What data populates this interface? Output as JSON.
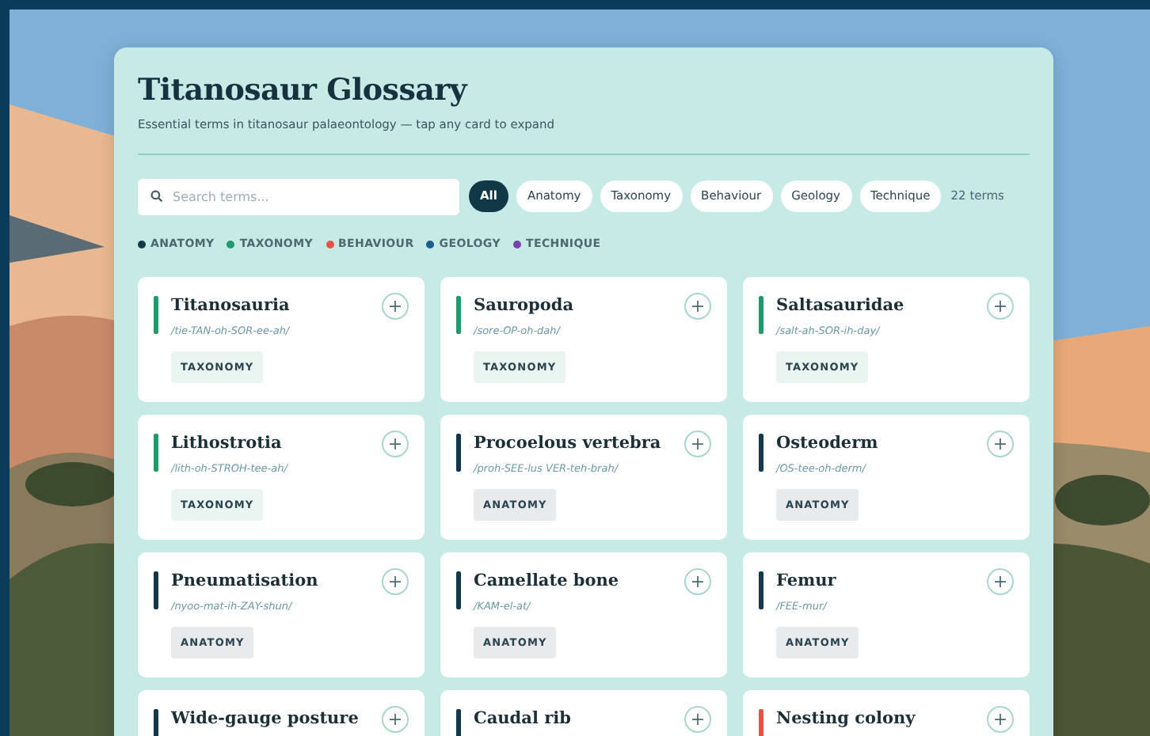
{
  "header": {
    "title": "Titanosaur Glossary",
    "subtitle": "Essential terms in titanosaur palaeontology — tap any card to expand"
  },
  "search": {
    "placeholder": "Search terms..."
  },
  "filters": [
    {
      "label": "All",
      "selected": true
    },
    {
      "label": "Anatomy",
      "selected": false
    },
    {
      "label": "Taxonomy",
      "selected": false
    },
    {
      "label": "Behaviour",
      "selected": false
    },
    {
      "label": "Geology",
      "selected": false
    },
    {
      "label": "Technique",
      "selected": false
    }
  ],
  "count": "22 terms",
  "legend": [
    {
      "label": "ANATOMY",
      "color": "#123a4a"
    },
    {
      "label": "TAXONOMY",
      "color": "#1f9a6a"
    },
    {
      "label": "BEHAVIOUR",
      "color": "#e8543f"
    },
    {
      "label": "GEOLOGY",
      "color": "#1f5f8f"
    },
    {
      "label": "TECHNIQUE",
      "color": "#7a3fb0"
    }
  ],
  "cards": [
    {
      "term": "Titanosauria",
      "pronunciation": "/tie-TAN-oh-SOR-ee-ah/",
      "tag": "TAXONOMY",
      "color": "#1f9a6a"
    },
    {
      "term": "Sauropoda",
      "pronunciation": "/sore-OP-oh-dah/",
      "tag": "TAXONOMY",
      "color": "#1f9a6a"
    },
    {
      "term": "Saltasauridae",
      "pronunciation": "/salt-ah-SOR-ih-day/",
      "tag": "TAXONOMY",
      "color": "#1f9a6a"
    },
    {
      "term": "Lithostrotia",
      "pronunciation": "/lith-oh-STROH-tee-ah/",
      "tag": "TAXONOMY",
      "color": "#1f9a6a"
    },
    {
      "term": "Procoelous vertebra",
      "pronunciation": "/proh-SEE-lus VER-teh-brah/",
      "tag": "ANATOMY",
      "color": "#123a4a"
    },
    {
      "term": "Osteoderm",
      "pronunciation": "/OS-tee-oh-derm/",
      "tag": "ANATOMY",
      "color": "#123a4a"
    },
    {
      "term": "Pneumatisation",
      "pronunciation": "/nyoo-mat-ih-ZAY-shun/",
      "tag": "ANATOMY",
      "color": "#123a4a"
    },
    {
      "term": "Camellate bone",
      "pronunciation": "/KAM-el-at/",
      "tag": "ANATOMY",
      "color": "#123a4a"
    },
    {
      "term": "Femur",
      "pronunciation": "/FEE-mur/",
      "tag": "ANATOMY",
      "color": "#123a4a"
    },
    {
      "term": "Wide-gauge posture",
      "color": "#123a4a"
    },
    {
      "term": "Caudal rib",
      "color": "#123a4a"
    },
    {
      "term": "Nesting colony",
      "color": "#e8543f"
    }
  ]
}
